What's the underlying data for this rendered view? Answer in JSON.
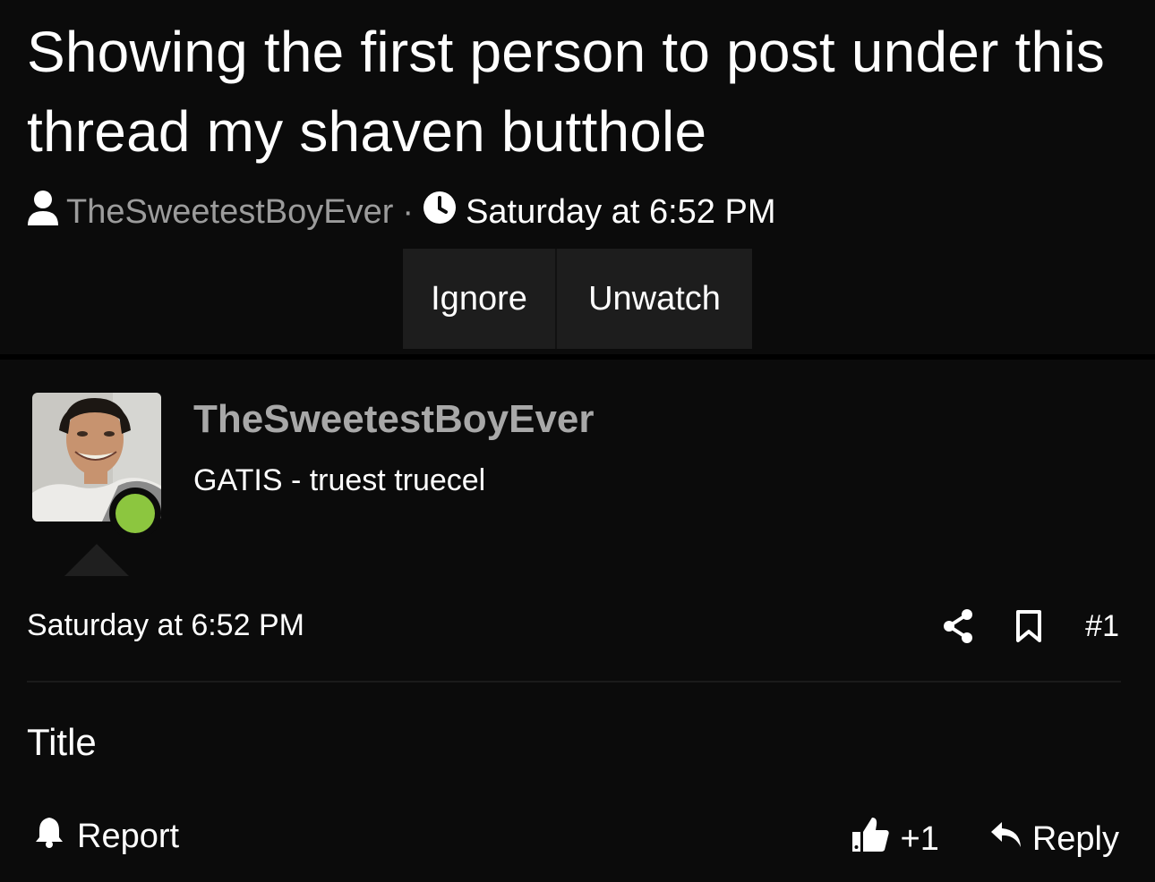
{
  "thread": {
    "title": "Showing the first person to post under this thread my shaven butthole",
    "author": "TheSweetestBoyEver",
    "separator": "·",
    "date": "Saturday at 6:52 PM",
    "buttons": {
      "ignore": "Ignore",
      "unwatch": "Unwatch"
    }
  },
  "post": {
    "username": "TheSweetestBoyEver",
    "user_title": "GATIS - truest truecel",
    "online": true,
    "date": "Saturday at 6:52 PM",
    "number": "#1",
    "body": "Title",
    "report_label": "Report",
    "like_count": "+1",
    "reply_label": "Reply"
  },
  "icons": {
    "author": "user-icon",
    "clock": "clock-icon",
    "share": "share-icon",
    "bookmark": "bookmark-icon",
    "report": "bell-icon",
    "like": "thumbs-up-icon",
    "reply": "reply-arrow-icon"
  },
  "colors": {
    "background": "#0b0b0b",
    "muted": "#9c9c9c",
    "button": "#1d1d1d",
    "online": "#8cc63f"
  }
}
